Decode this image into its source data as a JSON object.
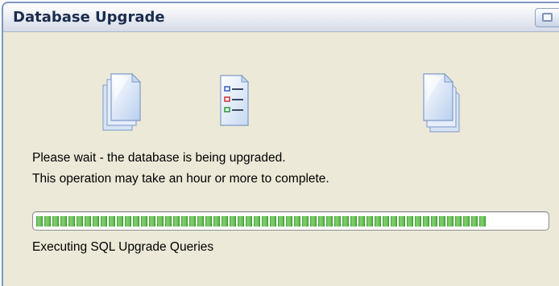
{
  "window": {
    "title": "Database Upgrade"
  },
  "icons": [
    {
      "name": "source-documents"
    },
    {
      "name": "sql-query-list"
    },
    {
      "name": "target-documents"
    }
  ],
  "message": {
    "line1": "Please wait - the database is being upgraded.",
    "line2": "This operation may take an hour or more to complete."
  },
  "progress": {
    "fraction": 0.88,
    "status": "Executing SQL Upgrade Queries"
  },
  "colors": {
    "title_text": "#1b2d4e",
    "progress_green": "#5cb84c",
    "window_background": "#ece9d8"
  }
}
